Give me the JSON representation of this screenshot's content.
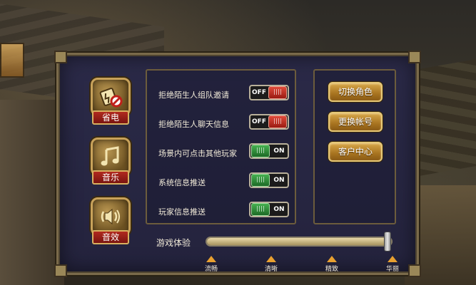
{
  "side_buttons": [
    {
      "label": "省电",
      "icon": "power-save-icon"
    },
    {
      "label": "音乐",
      "icon": "music-note-icon"
    },
    {
      "label": "音效",
      "icon": "speaker-icon"
    }
  ],
  "settings": [
    {
      "label": "拒绝陌生人组队邀请",
      "state": "OFF"
    },
    {
      "label": "拒绝陌生人聊天信息",
      "state": "OFF"
    },
    {
      "label": "场景内可点击其他玩家",
      "state": "ON"
    },
    {
      "label": "系统信息推送",
      "state": "ON"
    },
    {
      "label": "玩家信息推送",
      "state": "ON"
    }
  ],
  "account_buttons": [
    "切换角色",
    "更换帐号",
    "客户中心"
  ],
  "quality": {
    "label": "游戏体验",
    "levels": [
      "流畅",
      "清晰",
      "精致",
      "华丽"
    ],
    "value": 1.0
  },
  "colors": {
    "panel": "#2b2a48",
    "gold": "#d8a84a",
    "toggle_on": "#46b050",
    "toggle_off": "#e04a3a",
    "label_red": "#b12a20"
  }
}
